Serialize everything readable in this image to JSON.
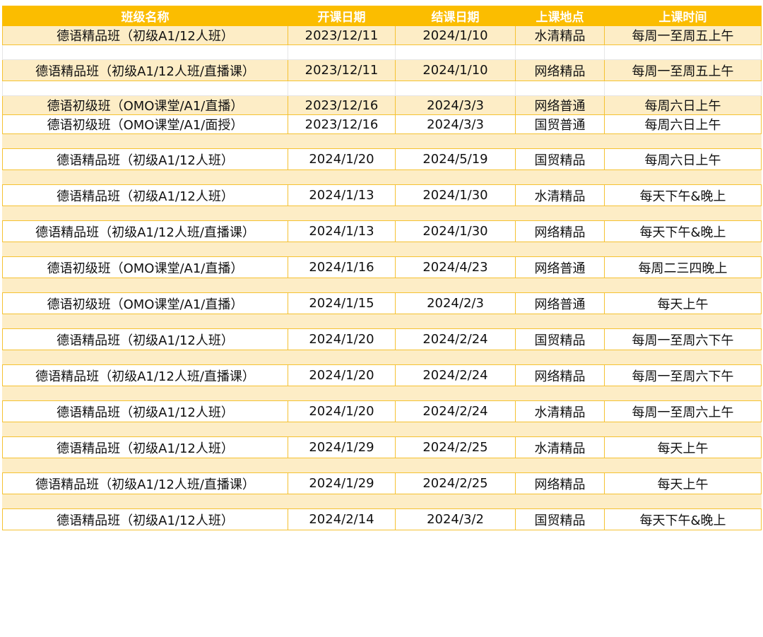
{
  "table": {
    "headers": [
      "班级名称",
      "开课日期",
      "结课日期",
      "上课地点",
      "上课时间"
    ],
    "rows": [
      {
        "type": "data",
        "bg": "beige",
        "size": "mid",
        "cells": [
          "德语精品班（初级A1/12人班）",
          "2023/12/11",
          "2024/1/10",
          "水清精品",
          "每周一至周五上午"
        ]
      },
      {
        "type": "gap",
        "bg": "white",
        "size": "blank"
      },
      {
        "type": "data",
        "bg": "beige",
        "size": "tall",
        "cells": [
          "德语精品班（初级A1/12人班/直播课）",
          "2023/12/11",
          "2024/1/10",
          "网络精品",
          "每周一至周五上午"
        ]
      },
      {
        "type": "gap",
        "bg": "white",
        "size": "blank"
      },
      {
        "type": "data",
        "bg": "beige",
        "size": "mid",
        "cells": [
          "德语初级班（OMO课堂/A1/直播）",
          "2023/12/16",
          "2024/3/3",
          "网络普通",
          "每周六日上午"
        ]
      },
      {
        "type": "data",
        "bg": "white",
        "size": "small",
        "cells": [
          "德语初级班（OMO课堂/A1/面授）",
          "2023/12/16",
          "2024/3/3",
          "国贸普通",
          "每周六日上午"
        ]
      },
      {
        "type": "gap",
        "bg": "beige",
        "size": "blank"
      },
      {
        "type": "data",
        "bg": "white",
        "size": "tall",
        "cells": [
          "德语精品班（初级A1/12人班）",
          "2024/1/20",
          "2024/5/19",
          "国贸精品",
          "每周六日上午"
        ]
      },
      {
        "type": "gap",
        "bg": "beige",
        "size": "blank"
      },
      {
        "type": "data",
        "bg": "white",
        "size": "tall",
        "cells": [
          "德语精品班（初级A1/12人班）",
          "2024/1/13",
          "2024/1/30",
          "水清精品",
          "每天下午&晚上"
        ]
      },
      {
        "type": "gap",
        "bg": "beige",
        "size": "blank"
      },
      {
        "type": "data",
        "bg": "white",
        "size": "tall",
        "cells": [
          "德语精品班（初级A1/12人班/直播课）",
          "2024/1/13",
          "2024/1/30",
          "网络精品",
          "每天下午&晚上"
        ]
      },
      {
        "type": "gap",
        "bg": "beige",
        "size": "blank"
      },
      {
        "type": "data",
        "bg": "white",
        "size": "tall",
        "cells": [
          "德语初级班（OMO课堂/A1/直播）",
          "2024/1/16",
          "2024/4/23",
          "网络普通",
          "每周二三四晚上"
        ]
      },
      {
        "type": "gap",
        "bg": "beige",
        "size": "blank"
      },
      {
        "type": "data",
        "bg": "white",
        "size": "tall",
        "cells": [
          "德语初级班（OMO课堂/A1/直播）",
          "2024/1/15",
          "2024/2/3",
          "网络普通",
          "每天上午"
        ]
      },
      {
        "type": "gap",
        "bg": "beige",
        "size": "blank"
      },
      {
        "type": "data",
        "bg": "white",
        "size": "tall",
        "cells": [
          "德语精品班（初级A1/12人班）",
          "2024/1/20",
          "2024/2/24",
          "国贸精品",
          "每周一至周六下午"
        ]
      },
      {
        "type": "gap",
        "bg": "beige",
        "size": "blank"
      },
      {
        "type": "data",
        "bg": "white",
        "size": "tall",
        "cells": [
          "德语精品班（初级A1/12人班/直播课）",
          "2024/1/20",
          "2024/2/24",
          "网络精品",
          "每周一至周六下午"
        ]
      },
      {
        "type": "gap",
        "bg": "beige",
        "size": "blank"
      },
      {
        "type": "data",
        "bg": "white",
        "size": "tall",
        "cells": [
          "德语精品班（初级A1/12人班）",
          "2024/1/20",
          "2024/2/24",
          "水清精品",
          "每周一至周六上午"
        ]
      },
      {
        "type": "gap",
        "bg": "beige",
        "size": "blank"
      },
      {
        "type": "data",
        "bg": "white",
        "size": "tall",
        "cells": [
          "德语精品班（初级A1/12人班）",
          "2024/1/29",
          "2024/2/25",
          "水清精品",
          "每天上午"
        ]
      },
      {
        "type": "gap",
        "bg": "beige",
        "size": "blank"
      },
      {
        "type": "data",
        "bg": "white",
        "size": "tall",
        "cells": [
          "德语精品班（初级A1/12人班/直播课）",
          "2024/1/29",
          "2024/2/25",
          "网络精品",
          "每天上午"
        ]
      },
      {
        "type": "gap",
        "bg": "beige",
        "size": "blank"
      },
      {
        "type": "data",
        "bg": "white",
        "size": "tall",
        "cells": [
          "德语精品班（初级A1/12人班）",
          "2024/2/14",
          "2024/3/2",
          "国贸精品",
          "每天下午&晚上"
        ]
      }
    ]
  }
}
